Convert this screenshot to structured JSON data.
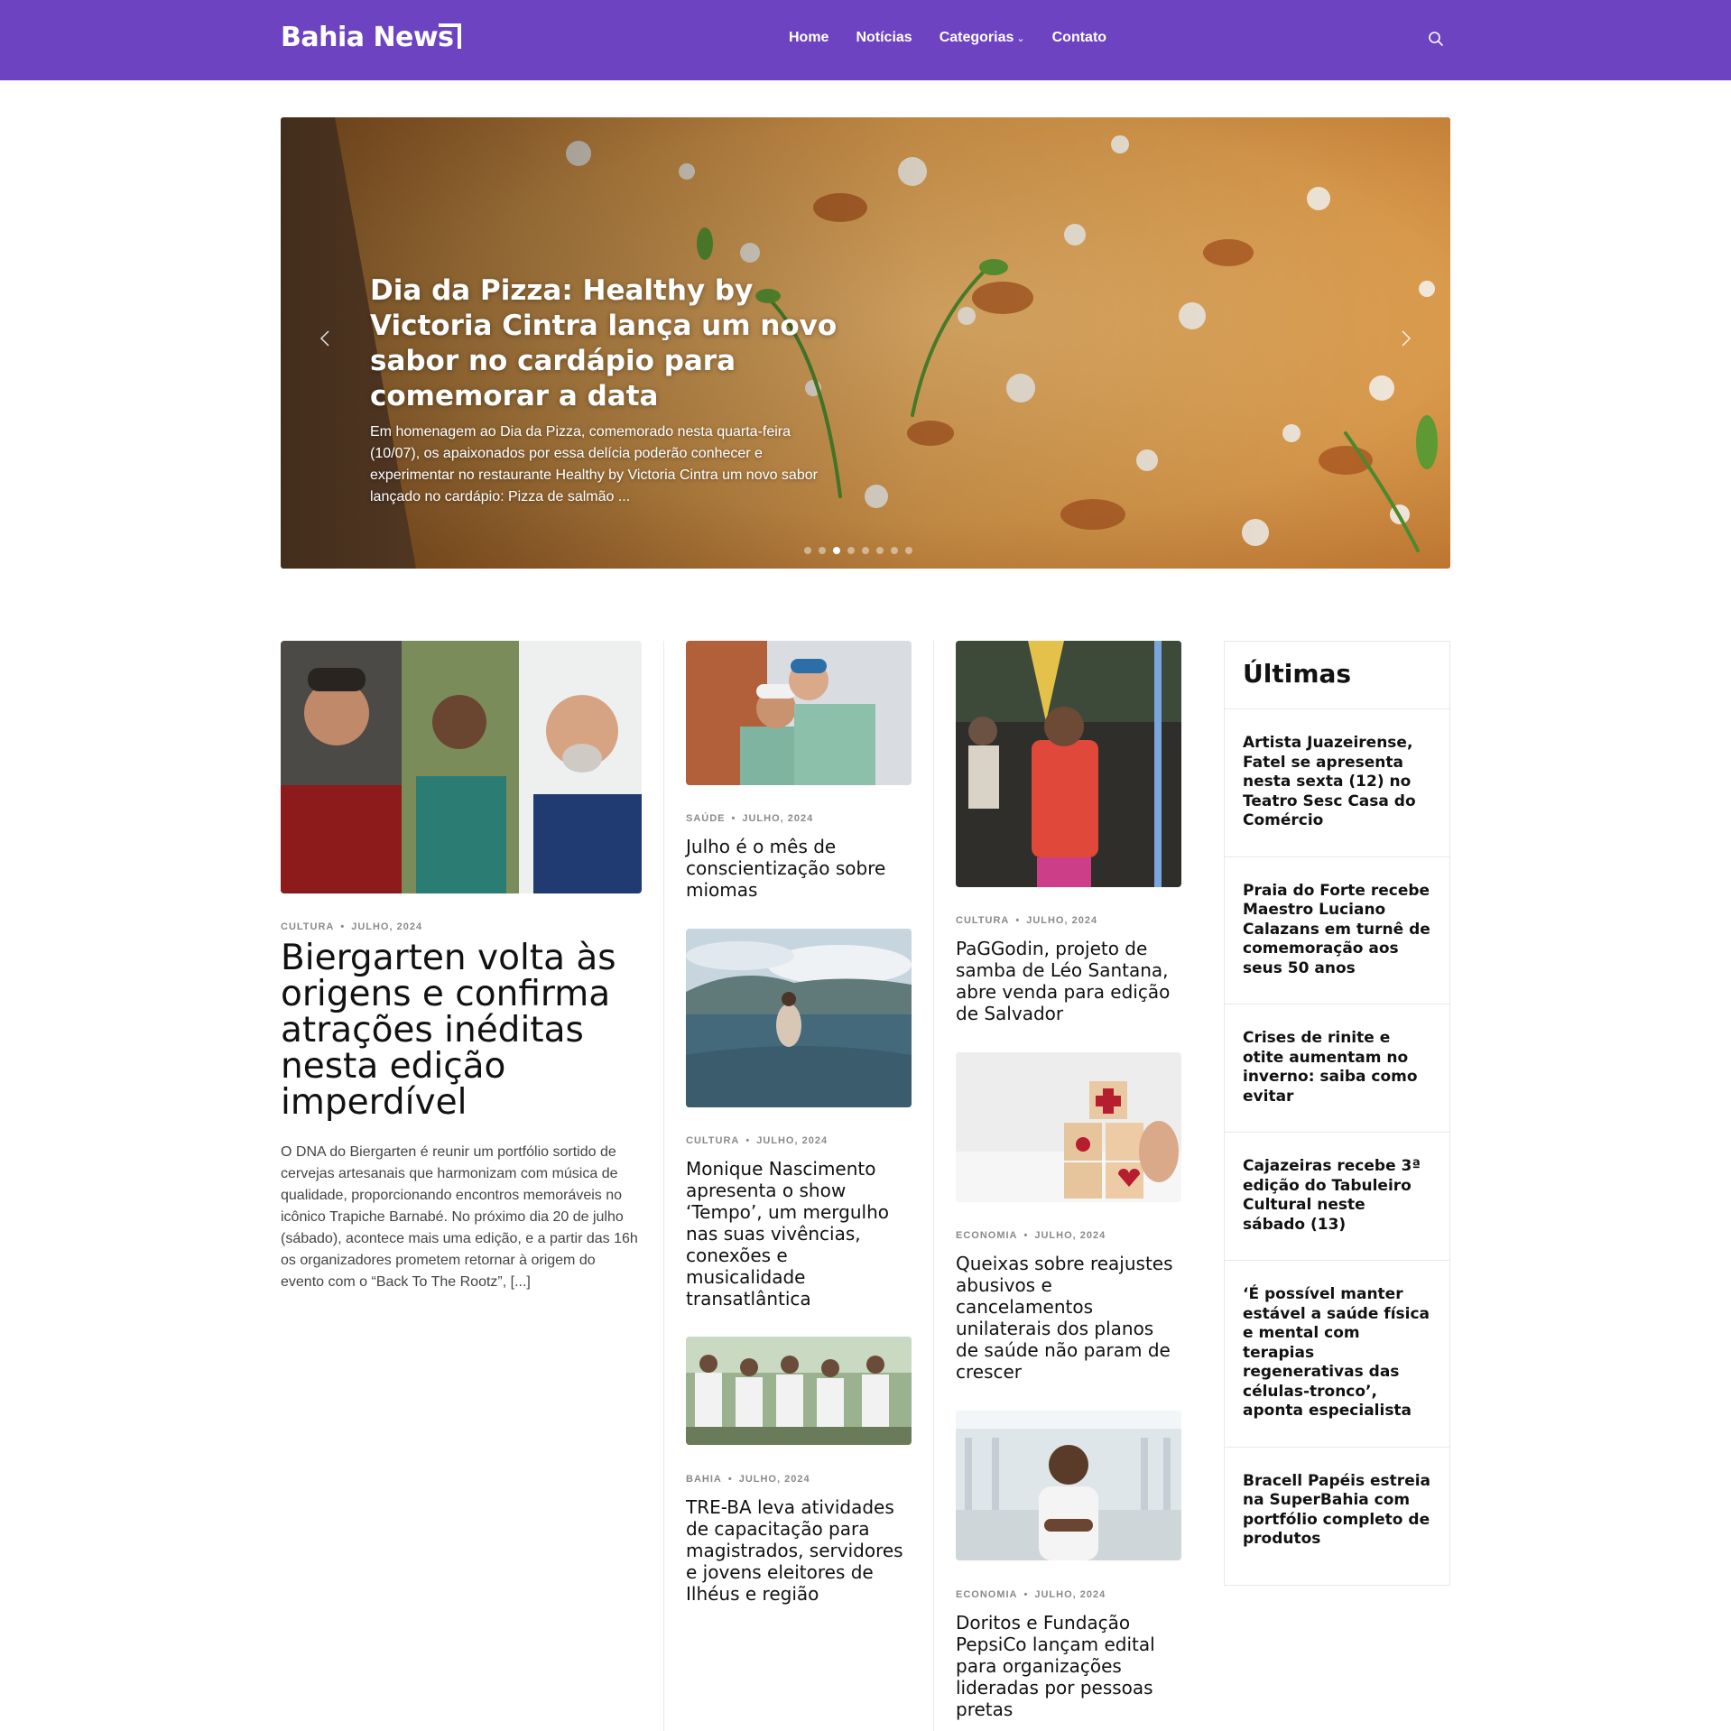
{
  "header": {
    "logo_text": "Bahia News",
    "nav": [
      {
        "label": "Home"
      },
      {
        "label": "Notícias"
      },
      {
        "label": "Categorias"
      },
      {
        "label": "Contato"
      }
    ],
    "accent_color": "#6e43c2"
  },
  "hero": {
    "title": "Dia da Pizza: Healthy by Victoria Cintra lança um novo sabor no cardápio para comemorar a data",
    "description": "Em homenagem ao Dia da Pizza, comemorado nesta quarta-feira (10/07), os apaixonados por essa delícia poderão conhecer e experimentar no restaurante Healthy by Victoria Cintra um novo sabor lançado no cardápio: Pizza de salmão ...",
    "dots_count": 8,
    "active_dot": 2
  },
  "featured": {
    "category": "CULTURA",
    "date": "JULHO, 2024",
    "title": "Biergarten volta às origens e confirma atrações inéditas nesta edição imperdível",
    "excerpt": "O DNA do Biergarten é reunir um portfólio sortido de cervejas artesanais que harmonizam com música de qualidade, proporcionando encontros memoráveis no icônico Trapiche Barnabé. No próximo dia 20 de julho (sábado), acontece mais uma edição, e a partir das 16h os organizadores prometem retornar à origem do evento com o “Back To The Rootz”, [...]"
  },
  "col2": [
    {
      "category": "SAÚDE",
      "date": "JULHO, 2024",
      "title": "Julho é o mês de conscientização sobre miomas"
    },
    {
      "category": "CULTURA",
      "date": "JULHO, 2024",
      "title": "Monique Nascimento apresenta o show ‘Tempo’, um mergulho nas suas vivências, conexões e musicalidade transatlântica"
    },
    {
      "category": "BAHIA",
      "date": "JULHO, 2024",
      "title": "TRE-BA leva atividades de capacitação para magistrados, servidores e jovens eleitores de Ilhéus e região"
    }
  ],
  "col3": [
    {
      "category": "CULTURA",
      "date": "JULHO, 2024",
      "title": "PaGGodin, projeto de samba de Léo Santana, abre venda para edição de Salvador"
    },
    {
      "category": "ECONOMIA",
      "date": "JULHO, 2024",
      "title": "Queixas sobre reajustes abusivos e cancelamentos unilaterais dos planos de saúde não param de crescer"
    },
    {
      "category": "ECONOMIA",
      "date": "JULHO, 2024",
      "title": "Doritos e Fundação PepsiCo lançam edital para organizações lideradas por pessoas pretas"
    }
  ],
  "sidebar": {
    "title": "Últimas",
    "items": [
      {
        "title": "Artista Juazeirense, Fatel se apresenta nesta sexta (12) no Teatro Sesc Casa do Comércio"
      },
      {
        "title": "Praia do Forte recebe Maestro Luciano Calazans em turnê de comemoração aos seus 50 anos"
      },
      {
        "title": "Crises de rinite e otite aumentam no inverno: saiba como evitar"
      },
      {
        "title": "Cajazeiras recebe 3ª edição do Tabuleiro Cultural neste sábado (13)"
      },
      {
        "title": "‘É possível manter estável a saúde física e mental com terapias regenerativas das células-tronco’, aponta especialista"
      },
      {
        "title": "Bracell Papéis estreia na SuperBahia com portfólio completo de produtos"
      }
    ]
  }
}
